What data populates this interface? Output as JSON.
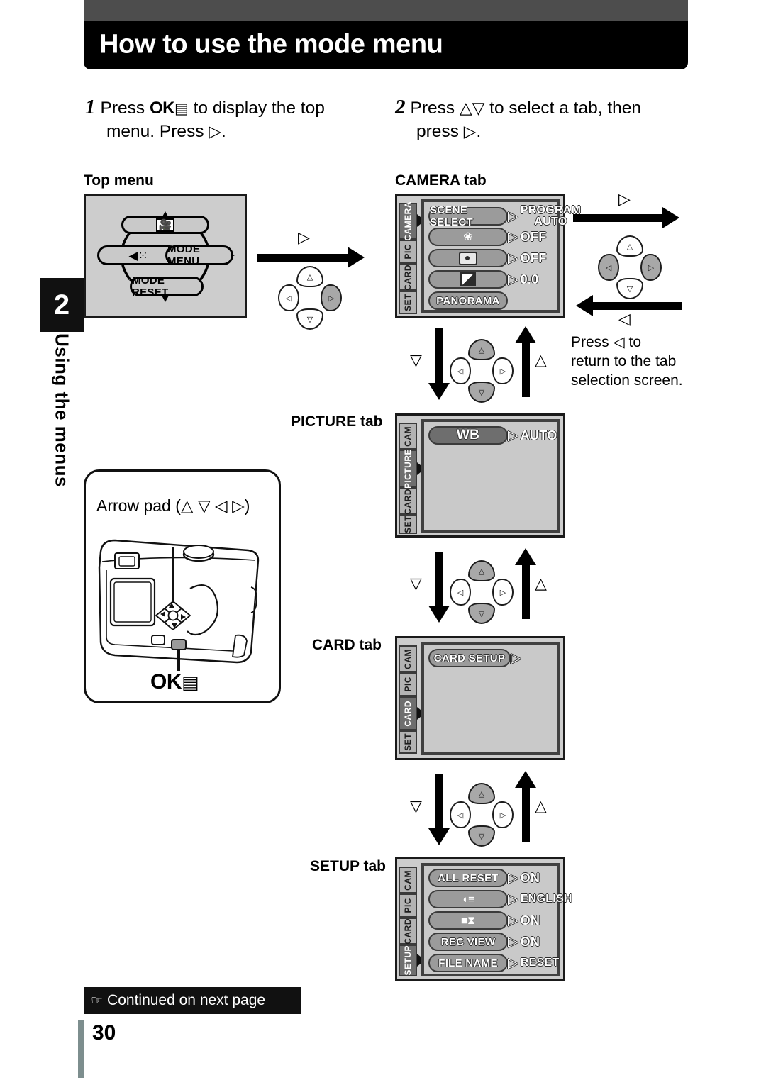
{
  "header": {
    "title": "How to use the mode menu"
  },
  "sidebar": {
    "chapter_number": "2",
    "chapter_label": "Using the menus"
  },
  "steps": [
    {
      "number": "1",
      "line1_a": "Press",
      "ok_button": "OK",
      "line1_b": "to display the top",
      "line2": "menu. Press",
      "line2_glyph": "▷",
      "line2_end": "."
    },
    {
      "number": "2",
      "line1_a": "Press",
      "glyph_up": "△",
      "glyph_down": "▽",
      "line1_b": "to select a tab, then",
      "line2": "press",
      "line2_glyph": "▷",
      "line2_end": "."
    }
  ],
  "top_menu": {
    "caption": "Top menu",
    "items": {
      "top": "movie-icon",
      "left": "flash-drive-icon",
      "right": "MODE MENU",
      "bottom": "MODE RESET"
    }
  },
  "flow_labels": {
    "right_arrow_1": "▷",
    "right_arrow_2": "▷",
    "left_arrow": "◁",
    "down_label": "▽",
    "up_label": "△",
    "return_note": "Press ◁ to return to the tab selection screen.",
    "return_note_l1": "Press ◁ to",
    "return_note_l2": "return to the tab",
    "return_note_l3": "selection screen."
  },
  "screens": [
    {
      "caption": "CAMERA tab",
      "tabs": [
        "CAMERA",
        "PIC",
        "CARD",
        "SET"
      ],
      "active_tab": "CAMERA",
      "rows": [
        {
          "label": "SCENE SELECT",
          "icon": null,
          "arrow": "▷",
          "value": "PROGRAM AUTO",
          "value_l1": "PROGRAM",
          "value_l2": "AUTO",
          "selected": false
        },
        {
          "label": "",
          "icon": "macro-tulip-icon",
          "arrow": "▷",
          "value": "OFF",
          "selected": false
        },
        {
          "label": "",
          "icon": "spot-metering-icon",
          "arrow": "▷",
          "value": "OFF",
          "selected": false
        },
        {
          "label": "",
          "icon": "exposure-compensation-icon",
          "arrow": "▷",
          "value": "0.0",
          "selected": false
        },
        {
          "label": "PANORAMA",
          "icon": null,
          "arrow": "",
          "value": "",
          "selected": false
        }
      ]
    },
    {
      "caption": "PICTURE tab",
      "tabs": [
        "CAM",
        "PICTURE",
        "CARD",
        "SET"
      ],
      "active_tab": "PICTURE",
      "rows": [
        {
          "label": "WB",
          "icon": null,
          "arrow": "▷",
          "value": "AUTO",
          "selected": true
        }
      ]
    },
    {
      "caption": "CARD tab",
      "tabs": [
        "CAM",
        "PIC",
        "CARD",
        "SET"
      ],
      "active_tab": "CARD",
      "rows": [
        {
          "label": "CARD SETUP",
          "icon": null,
          "arrow": "▷",
          "value": "",
          "selected": false
        }
      ]
    },
    {
      "caption": "SETUP tab",
      "tabs": [
        "CAM",
        "PIC",
        "CARD",
        "SETUP"
      ],
      "active_tab": "SETUP",
      "rows": [
        {
          "label": "ALL RESET",
          "icon": null,
          "arrow": "▷",
          "value": "ON",
          "selected": false
        },
        {
          "label": "",
          "icon": "language-icon",
          "arrow": "▷",
          "value": "ENGLISH",
          "selected": false
        },
        {
          "label": "",
          "icon": "beep-speaker-icon",
          "arrow": "▷",
          "value": "ON",
          "selected": false
        },
        {
          "label": "REC VIEW",
          "icon": null,
          "arrow": "▷",
          "value": "ON",
          "selected": false
        },
        {
          "label": "FILE NAME",
          "icon": null,
          "arrow": "▷",
          "value": "RESET",
          "selected": false
        }
      ]
    }
  ],
  "camera_illustration": {
    "arrow_pad_label": "Arrow pad (△ ▽ ◁ ▷)",
    "ok_label": "OK"
  },
  "footer": {
    "continued": "Continued on next page",
    "page_number": "30"
  },
  "colors": {
    "header_bar": "#000000",
    "header_gray": "#4d4d4d",
    "lcd_frame": "#cdcdcd",
    "lcd_panel": "#c9c9c9",
    "pill": "#9b9b9b",
    "pill_selected": "#6e6e6e",
    "tab_active": "#6f6f6f",
    "page_rule": "#7d8e8e"
  }
}
